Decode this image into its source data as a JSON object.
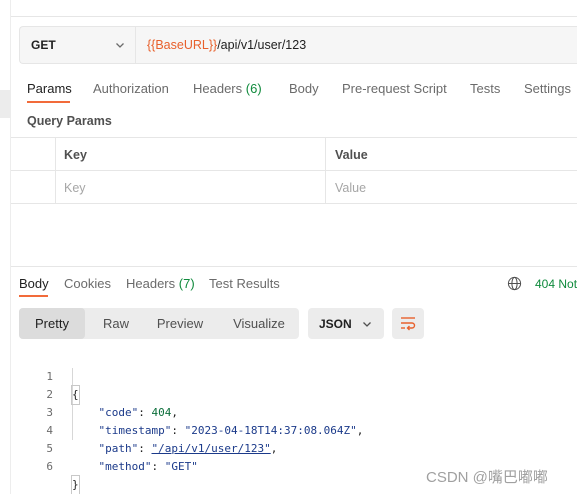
{
  "request": {
    "method": "GET",
    "url_var": "{{BaseURL}}",
    "url_path": "/api/v1/user/123"
  },
  "request_tabs": [
    {
      "label": "Params",
      "active": true
    },
    {
      "label": "Authorization"
    },
    {
      "label": "Headers",
      "count": "(6)"
    },
    {
      "label": "Body"
    },
    {
      "label": "Pre-request Script"
    },
    {
      "label": "Tests"
    },
    {
      "label": "Settings"
    }
  ],
  "query_params": {
    "title": "Query Params",
    "headers": {
      "key": "Key",
      "value": "Value"
    },
    "placeholders": {
      "key": "Key",
      "value": "Value"
    }
  },
  "response": {
    "tabs": [
      {
        "label": "Body",
        "active": true
      },
      {
        "label": "Cookies"
      },
      {
        "label": "Headers",
        "count": "(7)"
      },
      {
        "label": "Test Results"
      }
    ],
    "status": "404 Not",
    "view_modes": [
      "Pretty",
      "Raw",
      "Preview",
      "Visualize"
    ],
    "active_view": "Pretty",
    "format": "JSON",
    "code_lines": [
      {
        "n": "1",
        "text": "{"
      },
      {
        "n": "2",
        "key": "\"code\"",
        "value": "404",
        "type": "num"
      },
      {
        "n": "3",
        "key": "\"timestamp\"",
        "value": "\"2023-04-18T14:37:08.064Z\"",
        "type": "str"
      },
      {
        "n": "4",
        "key": "\"path\"",
        "value": "\"/api/v1/user/123\"",
        "type": "link"
      },
      {
        "n": "5",
        "key": "\"method\"",
        "value": "\"GET\"",
        "type": "str",
        "last": true
      },
      {
        "n": "6",
        "text": "}"
      }
    ]
  },
  "watermark": "CSDN @嘴巴嘟嘟",
  "colors": {
    "accent": "#f26b3a",
    "var": "#e8602c",
    "status": "#0f8a3c",
    "json_key": "#1b3a8a"
  },
  "icons": [
    "chevron-down-icon",
    "globe-icon",
    "wrap-lines-icon"
  ]
}
